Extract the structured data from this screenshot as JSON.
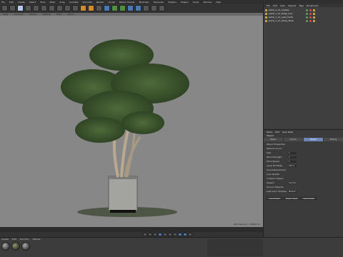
{
  "menubar": {
    "items": [
      "File",
      "Edit",
      "Create",
      "Select",
      "Tools",
      "Mesh",
      "Snap",
      "Animate",
      "Simulate",
      "Render",
      "Sculpt",
      "Motion Tracker",
      "MoGraph",
      "Character",
      "Pipeline",
      "Plugins",
      "Script",
      "Window",
      "Help"
    ]
  },
  "viewport": {
    "menu": [
      "View",
      "Cameras",
      "Display",
      "Options",
      "Filter",
      "Panel"
    ],
    "status": "Grid Spacing : 10000 cm"
  },
  "object_manager": {
    "menu": [
      "File",
      "Edit",
      "View",
      "Objects",
      "Tags",
      "Bookmarks"
    ],
    "objects": [
      {
        "label": "plant_1_C1_Collisio"
      },
      {
        "label": "plant_1_C1_Potgr_mot"
      },
      {
        "label": "plant_1_C1_Leaf_Cloth"
      },
      {
        "label": "plant_1_C1_Dropl_Strip"
      }
    ]
  },
  "attributes": {
    "menu": [
      "Mode",
      "Edit",
      "User Data"
    ],
    "title": "Object",
    "tabs": [
      "Basic",
      "Coord.",
      "Object",
      "Phong"
    ],
    "active_tab": "Object",
    "rows": [
      {
        "k": "Object Properties",
        "v": ""
      },
      {
        "k": "Texture Coord.",
        "v": ""
      },
      {
        "k": "Size",
        "v": "1"
      },
      {
        "k": "Wind Strength",
        "v": "1"
      },
      {
        "k": "Wind Speed",
        "v": "1"
      },
      {
        "k": "Level Of Detail",
        "v": "100 %"
      },
      {
        "k": "Use Displacement",
        "v": ""
      },
      {
        "k": "Live Update",
        "v": ""
      },
      {
        "k": "Collision Object",
        "v": ""
      },
      {
        "k": "Season",
        "v": "Summer"
      },
      {
        "k": "Ground Objects",
        "v": ""
      },
      {
        "k": "Leaf Color Variation",
        "v": "Medium"
      }
    ],
    "buttons": [
      "Load Preset",
      "Export Asset",
      "Save Preset"
    ]
  },
  "materials": {
    "menu": [
      "Create",
      "Edit",
      "Function",
      "Texture"
    ],
    "count": 3
  }
}
